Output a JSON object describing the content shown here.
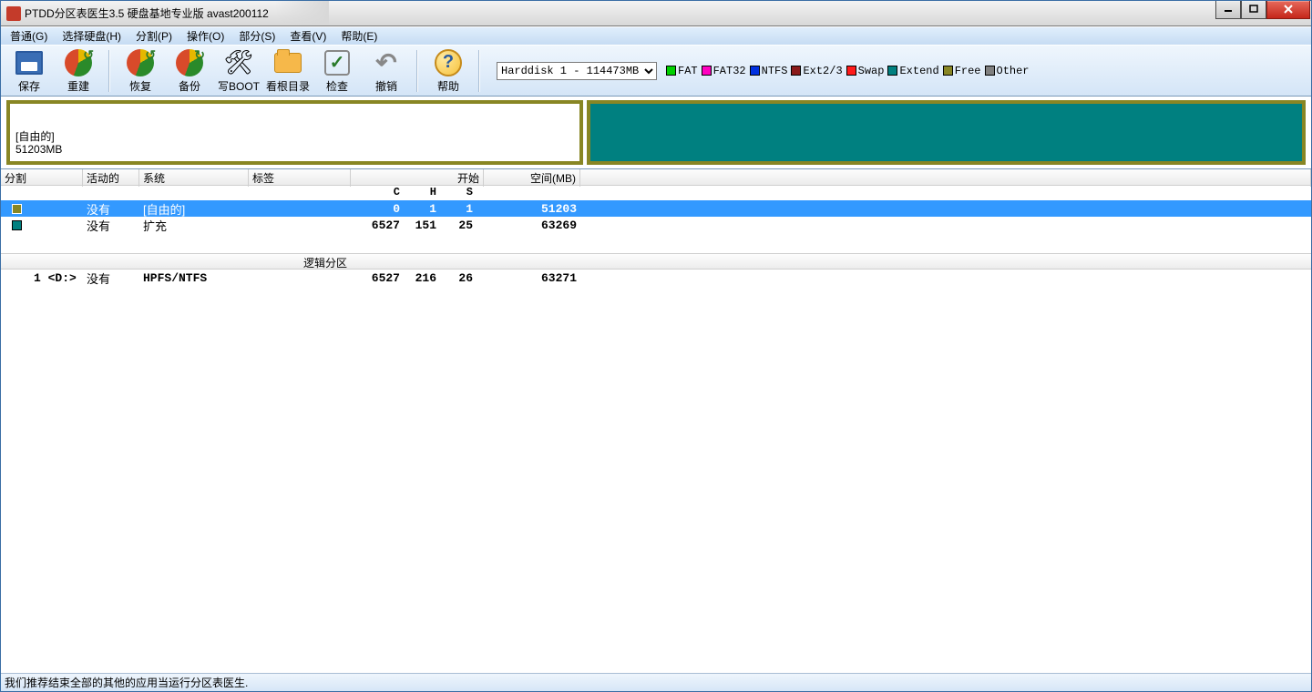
{
  "window": {
    "title": "PTDD分区表医生3.5 硬盘基地专业版 avast200112"
  },
  "menu": {
    "items": [
      "普通(G)",
      "选择硬盘(H)",
      "分割(P)",
      "操作(O)",
      "部分(S)",
      "查看(V)",
      "帮助(E)"
    ]
  },
  "toolbar": {
    "buttons": [
      {
        "name": "save",
        "label": "保存"
      },
      {
        "name": "rebuild",
        "label": "重建"
      },
      {
        "name": "restore",
        "label": "恢复"
      },
      {
        "name": "backup",
        "label": "备份"
      },
      {
        "name": "writeboot",
        "label": "写BOOT"
      },
      {
        "name": "viewroot",
        "label": "看根目录"
      },
      {
        "name": "check",
        "label": "检查"
      },
      {
        "name": "undo",
        "label": "撤销"
      },
      {
        "name": "help",
        "label": "帮助"
      }
    ]
  },
  "diskselect": {
    "value": "Harddisk 1 - 114473MB"
  },
  "legend": [
    {
      "label": "FAT",
      "color": "#00d000"
    },
    {
      "label": "FAT32",
      "color": "#ff00c0"
    },
    {
      "label": "NTFS",
      "color": "#0030e0"
    },
    {
      "label": "Ext2/3",
      "color": "#8a1a1a"
    },
    {
      "label": "Swap",
      "color": "#ff1a1a"
    },
    {
      "label": "Extend",
      "color": "#008080"
    },
    {
      "label": "Free",
      "color": "#888624"
    },
    {
      "label": "Other",
      "color": "#808080"
    }
  ],
  "diskmap": {
    "seg1": {
      "line1": "[自由的]",
      "line2": "51203MB"
    }
  },
  "columns": {
    "c0": "分割",
    "c1": "活动的",
    "c2": "系统",
    "c3": "标签",
    "c4": "开始",
    "c5": "空间(MB)"
  },
  "chs": {
    "c": "C",
    "h": "H",
    "s": "S"
  },
  "rows": [
    {
      "selected": true,
      "color": "#888624",
      "active": "没有",
      "system": "[自由的]",
      "label": "",
      "c": "0",
      "h": "1",
      "s": "1",
      "size": "51203"
    },
    {
      "selected": false,
      "color": "#008080",
      "active": "没有",
      "system": "扩充",
      "label": "",
      "c": "6527",
      "h": "151",
      "s": "25",
      "size": "63269"
    }
  ],
  "logical": {
    "title": "逻辑分区",
    "row": {
      "index": "1 <D:>",
      "active": "没有",
      "system": "HPFS/NTFS",
      "c": "6527",
      "h": "216",
      "s": "26",
      "size": "63271"
    }
  },
  "status": {
    "text": "我们推荐结束全部的其他的应用当运行分区表医生."
  }
}
